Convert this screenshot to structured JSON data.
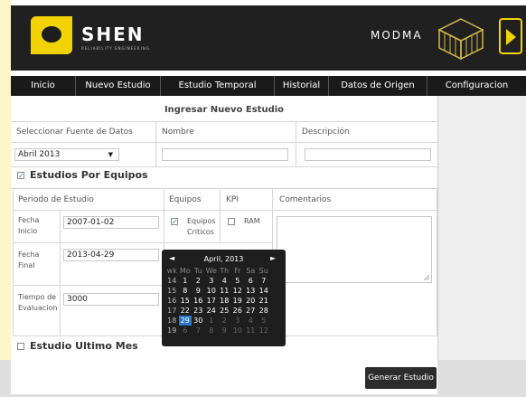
{
  "header": {
    "logo_text": "SHEN",
    "logo_sub": "RELIABILITY ENGINEERING",
    "modma": "MODMA"
  },
  "nav": {
    "items": [
      "Inicio",
      "Nuevo Estudio",
      "Estudio Temporal",
      "Historial",
      "Datos de Origen",
      "Configuracion"
    ]
  },
  "form": {
    "section_title": "Ingresar Nuevo Estudio",
    "source_label": "Seleccionar Fuente de Datos",
    "name_label": "Nombre",
    "desc_label": "Descripción",
    "source_value": "Abril 2013",
    "estudios_equipos": "Estudios Por Equipos",
    "periodo_label": "Periodo de Estudio",
    "equipos_label": "Equipos",
    "kpi_label": "KPI",
    "comentarios_label": "Comentarios",
    "fecha_inicio_label": "Fecha Inicio",
    "fecha_inicio_value": "2007-01-02",
    "fecha_final_label": "Fecha Final",
    "fecha_final_value": "2013-04-29",
    "tiempo_label": "Tiempo de Evaluacion",
    "tiempo_value": "3000",
    "equipos_criticos": "Equipos Criticos",
    "ram": "RAM",
    "estudio_ultimo_mes": "Estudio Ultimo Mes",
    "generar": "Generar Estudio"
  },
  "datepicker": {
    "title": "April, 2013",
    "prev": "◄",
    "next": "►",
    "headers": [
      "wk",
      "Mo",
      "Tu",
      "We",
      "Th",
      "Fr",
      "Sa",
      "Su"
    ],
    "rows": [
      [
        "14",
        "1",
        "2",
        "3",
        "4",
        "5",
        "6",
        "7"
      ],
      [
        "15",
        "8",
        "9",
        "10",
        "11",
        "12",
        "13",
        "14"
      ],
      [
        "16",
        "15",
        "16",
        "17",
        "18",
        "19",
        "20",
        "21"
      ],
      [
        "17",
        "22",
        "23",
        "24",
        "25",
        "26",
        "27",
        "28"
      ],
      [
        "18",
        "29",
        "30",
        "1",
        "2",
        "3",
        "4",
        "5"
      ],
      [
        "19",
        "6",
        "7",
        "8",
        "9",
        "10",
        "11",
        "12"
      ]
    ],
    "selected": "29"
  },
  "colors": {
    "accent": "#f2d200",
    "header_bg": "#202020",
    "nav_bg": "#1a1a1a",
    "selected_day": "#2a77c9"
  }
}
